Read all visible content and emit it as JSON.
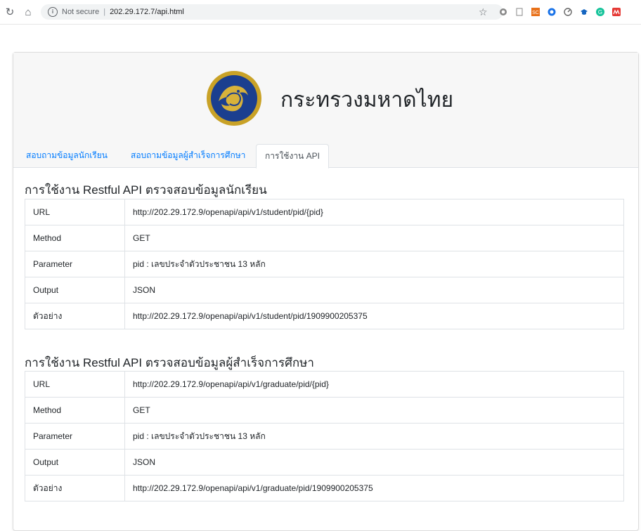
{
  "browser": {
    "security_label": "Not secure",
    "address": "202.29.172.7/api.html",
    "info_symbol": "i",
    "sc_label": "SC"
  },
  "header": {
    "org_name": "กระทรวงมหาดไทย"
  },
  "tabs": [
    {
      "label": "สอบถามข้อมูลนักเรียน"
    },
    {
      "label": "สอบถามข้อมูลผู้สำเร็จการศึกษา"
    },
    {
      "label": "การใช้งาน API",
      "active": true
    }
  ],
  "sections": [
    {
      "title": "การใช้งาน Restful API ตรวจสอบข้อมูลนักเรียน",
      "rows": [
        {
          "key": "URL",
          "value": "http://202.29.172.9/openapi/api/v1/student/pid/{pid}"
        },
        {
          "key": "Method",
          "value": "GET"
        },
        {
          "key": "Parameter",
          "value": "pid : เลขประจำตัวประชาชน 13 หลัก"
        },
        {
          "key": "Output",
          "value": "JSON"
        },
        {
          "key": "ตัวอย่าง",
          "value": "http://202.29.172.9/openapi/api/v1/student/pid/1909900205375"
        }
      ]
    },
    {
      "title": "การใช้งาน Restful API ตรวจสอบข้อมูลผู้สำเร็จการศึกษา",
      "rows": [
        {
          "key": "URL",
          "value": "http://202.29.172.9/openapi/api/v1/graduate/pid/{pid}"
        },
        {
          "key": "Method",
          "value": "GET"
        },
        {
          "key": "Parameter",
          "value": "pid : เลขประจำตัวประชาชน 13 หลัก"
        },
        {
          "key": "Output",
          "value": "JSON"
        },
        {
          "key": "ตัวอย่าง",
          "value": "http://202.29.172.9/openapi/api/v1/graduate/pid/1909900205375"
        }
      ]
    }
  ]
}
